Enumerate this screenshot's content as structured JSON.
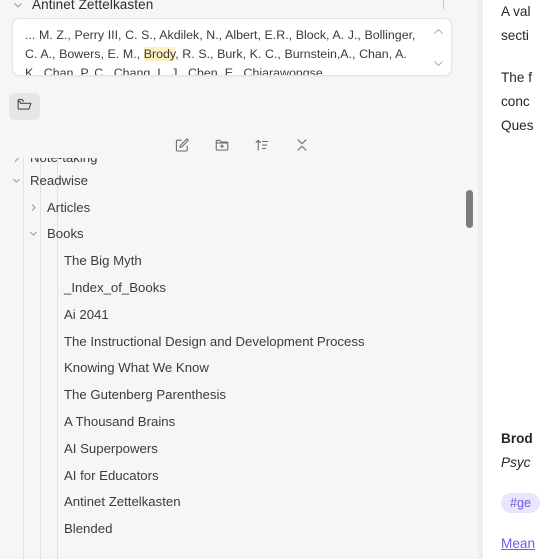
{
  "citation_panel": {
    "title": "Antinet Zettelkasten",
    "collapse_icon": "chevron-down-icon",
    "scroll_up_icon": "chevron-up-icon",
    "scroll_down_icon": "chevron-down-icon",
    "text_before": "... M. Z., Perry III, C. S., Akdilek, N., Albert, E.R., Block, A. J., Bollinger, C. A., Bowers, E. M., ",
    "highlight": "Brody",
    "text_after": ", R. S., Burk, K. C., Burnstein,A., Chan, A. K., Chan, P. C., Chang, L. J., Chen, E., Chiarawongse,...",
    "highlight_color": "#fcf0bf"
  },
  "tabstrip": {
    "active_tab_icon": "folder-icon",
    "active_tab_name": "File explorer"
  },
  "toolbar": {
    "items": [
      {
        "name": "new-note-button",
        "icon": "pencil-square-icon"
      },
      {
        "name": "new-folder-button",
        "icon": "folder-plus-icon"
      },
      {
        "name": "change-sort-order-button",
        "icon": "sort-ascending-icon"
      },
      {
        "name": "collapse-all-button",
        "icon": "collapse-all-icon"
      }
    ]
  },
  "tree": {
    "items": [
      {
        "label": "Note-taking",
        "depth": 0,
        "state": "collapsed",
        "type": "folder",
        "clipped": true
      },
      {
        "label": "Readwise",
        "depth": 0,
        "state": "expanded",
        "type": "folder"
      },
      {
        "label": "Articles",
        "depth": 1,
        "state": "collapsed",
        "type": "folder"
      },
      {
        "label": "Books",
        "depth": 1,
        "state": "expanded",
        "type": "folder"
      },
      {
        "label": "The Big Myth",
        "depth": 2,
        "state": "none",
        "type": "file"
      },
      {
        "label": "_Index_of_Books",
        "depth": 2,
        "state": "none",
        "type": "file"
      },
      {
        "label": "Ai 2041",
        "depth": 2,
        "state": "none",
        "type": "file"
      },
      {
        "label": "The Instructional Design and Development Process",
        "depth": 2,
        "state": "none",
        "type": "file"
      },
      {
        "label": "Knowing What We Know",
        "depth": 2,
        "state": "none",
        "type": "file"
      },
      {
        "label": "The Gutenberg Parenthesis",
        "depth": 2,
        "state": "none",
        "type": "file"
      },
      {
        "label": "A Thousand Brains",
        "depth": 2,
        "state": "none",
        "type": "file"
      },
      {
        "label": "AI Superpowers",
        "depth": 2,
        "state": "none",
        "type": "file"
      },
      {
        "label": "AI for Educators",
        "depth": 2,
        "state": "none",
        "type": "file"
      },
      {
        "label": "Antinet Zettelkasten",
        "depth": 2,
        "state": "none",
        "type": "file"
      },
      {
        "label": "Blended",
        "depth": 2,
        "state": "none",
        "type": "file"
      }
    ],
    "scrollbar": {
      "name": "tree-scrollbar",
      "thumb_top_pct": 8,
      "thumb_height_pct": 9
    }
  },
  "right_pane": {
    "lines": [
      {
        "text": "A val",
        "style": "normal"
      },
      {
        "text": "secti",
        "style": "normal"
      },
      {
        "text": "The f",
        "style": "normal"
      },
      {
        "text": "conc",
        "style": "normal"
      },
      {
        "text": "Ques",
        "style": "normal"
      }
    ],
    "author_line": "Brod",
    "source_line": "Psyc",
    "tag": "#ge",
    "link": "Mean",
    "tag_bg": "#e9e6fb",
    "tag_color": "#6b5ce7",
    "link_color": "#6b5ce7"
  }
}
